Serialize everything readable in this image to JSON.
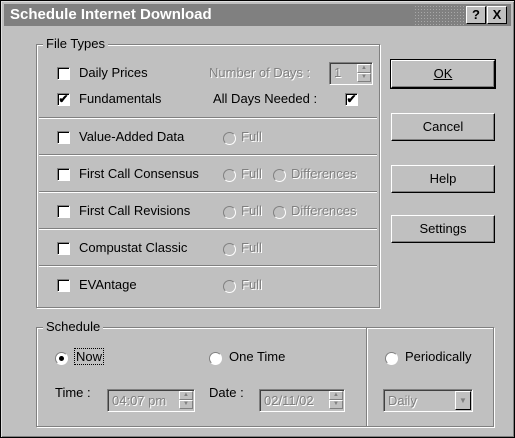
{
  "window": {
    "title": "Schedule Internet Download",
    "help_btn": "?",
    "close_btn": "X"
  },
  "file_types": {
    "legend": "File Types",
    "daily_prices": {
      "label": "Daily Prices",
      "checked": false
    },
    "number_of_days_label": "Number of Days :",
    "number_of_days_value": "1",
    "fundamentals": {
      "label": "Fundamentals",
      "checked": true
    },
    "all_days_needed_label": "All Days Needed :",
    "all_days_needed_checked": true,
    "value_added": {
      "label": "Value-Added Data",
      "full": "Full"
    },
    "first_call_consensus": {
      "label": "First Call Consensus",
      "full": "Full",
      "differences": "Differences"
    },
    "first_call_revisions": {
      "label": "First Call Revisions",
      "full": "Full",
      "differences": "Differences"
    },
    "compustat_classic": {
      "label": "Compustat Classic",
      "full": "Full"
    },
    "evantage": {
      "label": "EVAntage",
      "full": "Full"
    }
  },
  "buttons": {
    "ok": "OK",
    "cancel": "Cancel",
    "help": "Help",
    "settings": "Settings"
  },
  "schedule": {
    "legend": "Schedule",
    "now": "Now",
    "one_time": "One Time",
    "periodically": "Periodically",
    "selected": "Now",
    "time_label": "Time :",
    "time_value": "04:07 pm",
    "date_label": "Date :",
    "date_value": "02/11/02",
    "frequency_value": "Daily"
  },
  "check_mark": "✔"
}
